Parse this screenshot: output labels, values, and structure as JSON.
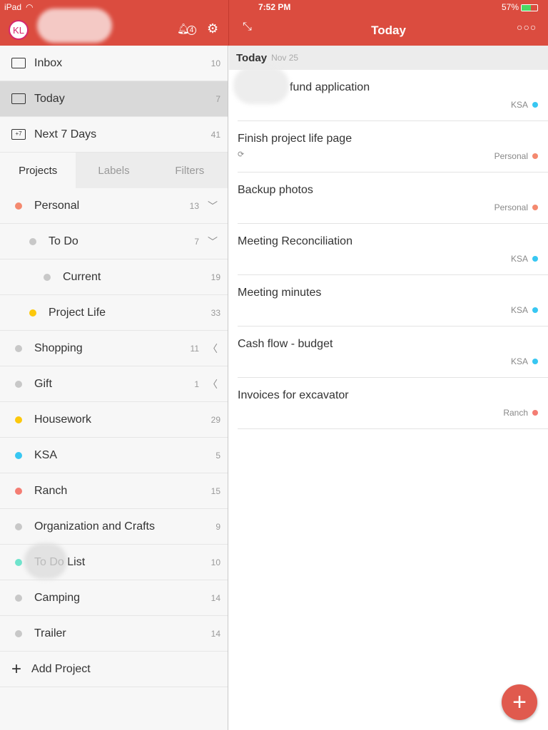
{
  "status": {
    "device": "iPad",
    "time": "7:52 PM",
    "battery": "57%"
  },
  "header": {
    "avatar": "KL",
    "notifications": "4",
    "title": "Today"
  },
  "nav": [
    {
      "label": "Inbox",
      "count": "10"
    },
    {
      "label": "Today",
      "count": "7"
    },
    {
      "label": "Next 7 Days",
      "count": "41",
      "icon_text": "+7"
    }
  ],
  "tabs": [
    "Projects",
    "Labels",
    "Filters"
  ],
  "projects": [
    {
      "name": "Personal",
      "count": "13",
      "color": "#f4896f",
      "indent": 0,
      "chev": "expanded"
    },
    {
      "name": "To Do",
      "count": "7",
      "color": "#c8c8c8",
      "indent": 1,
      "chev": "expanded"
    },
    {
      "name": "Current",
      "count": "19",
      "color": "#c8c8c8",
      "indent": 2
    },
    {
      "name": "Project Life",
      "count": "33",
      "color": "#fcc80c",
      "indent": 1
    },
    {
      "name": "Shopping",
      "count": "11",
      "color": "#c8c8c8",
      "indent": 0,
      "chev": "collapsed"
    },
    {
      "name": "Gift",
      "count": "1",
      "color": "#c8c8c8",
      "indent": 0,
      "chev": "collapsed"
    },
    {
      "name": "Housework",
      "count": "29",
      "color": "#fcc80c",
      "indent": 0
    },
    {
      "name": "KSA",
      "count": "5",
      "color": "#38c7f2",
      "indent": 0
    },
    {
      "name": "Ranch",
      "count": "15",
      "color": "#f47d73",
      "indent": 0
    },
    {
      "name": "Organization and Crafts",
      "count": "9",
      "color": "#c8c8c8",
      "indent": 0
    },
    {
      "name": "To Do List",
      "count": "10",
      "color": "#6fe3cc",
      "indent": 0
    },
    {
      "name": "Camping",
      "count": "14",
      "color": "#c8c8c8",
      "indent": 0
    },
    {
      "name": "Trailer",
      "count": "14",
      "color": "#c8c8c8",
      "indent": 0
    }
  ],
  "add_project": "Add Project",
  "section": {
    "title": "Today",
    "date": "Nov 25"
  },
  "tasks": [
    {
      "title": "fund application",
      "project": "KSA",
      "color": "#38c7f2"
    },
    {
      "title": "Finish project life page",
      "project": "Personal",
      "color": "#f4896f",
      "recurring": true
    },
    {
      "title": "Backup photos",
      "project": "Personal",
      "color": "#f4896f"
    },
    {
      "title": "Meeting Reconciliation",
      "project": "KSA",
      "color": "#38c7f2"
    },
    {
      "title": "Meeting minutes",
      "project": "KSA",
      "color": "#38c7f2"
    },
    {
      "title": "Cash flow - budget",
      "project": "KSA",
      "color": "#38c7f2"
    },
    {
      "title": "Invoices for excavator",
      "project": "Ranch",
      "color": "#f47d73"
    }
  ],
  "fab": "+"
}
